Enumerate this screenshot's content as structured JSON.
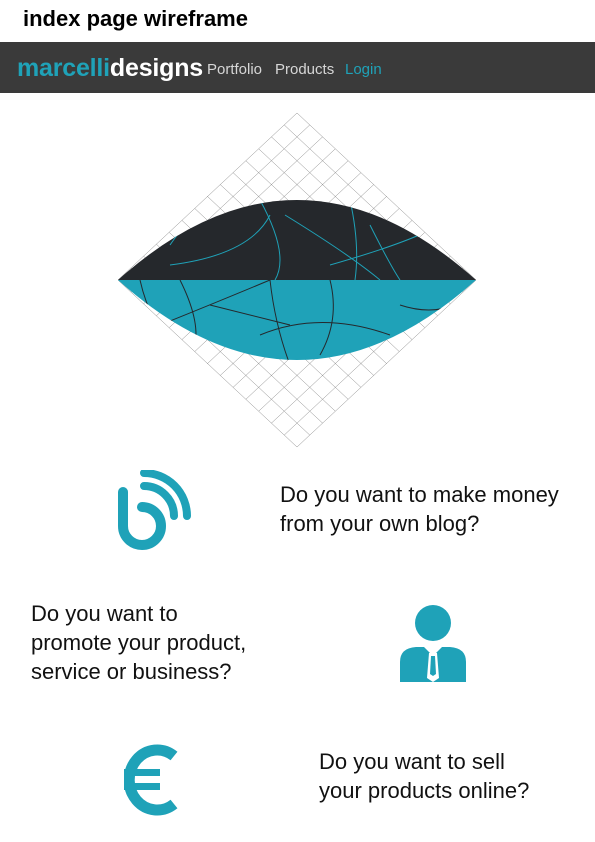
{
  "page_title": "index page wireframe",
  "navbar": {
    "brand_part1": "marcelli",
    "brand_part2": "designs",
    "items": [
      {
        "label": "Portfolio"
      },
      {
        "label": "Products"
      },
      {
        "label": "Login"
      }
    ]
  },
  "colors": {
    "accent": "#1fa2b8",
    "dark": "#25282c",
    "navbar_bg": "#3a3a3a"
  },
  "sections": [
    {
      "icon": "blog-rss-icon",
      "lines": [
        "Do you want to make money",
        "from your own blog?"
      ]
    },
    {
      "icon": "businessman-icon",
      "lines": [
        "Do you want to",
        "promote your product,",
        "service or business?"
      ]
    },
    {
      "icon": "euro-icon",
      "lines": [
        "Do you want to sell",
        "your products online?"
      ]
    }
  ]
}
